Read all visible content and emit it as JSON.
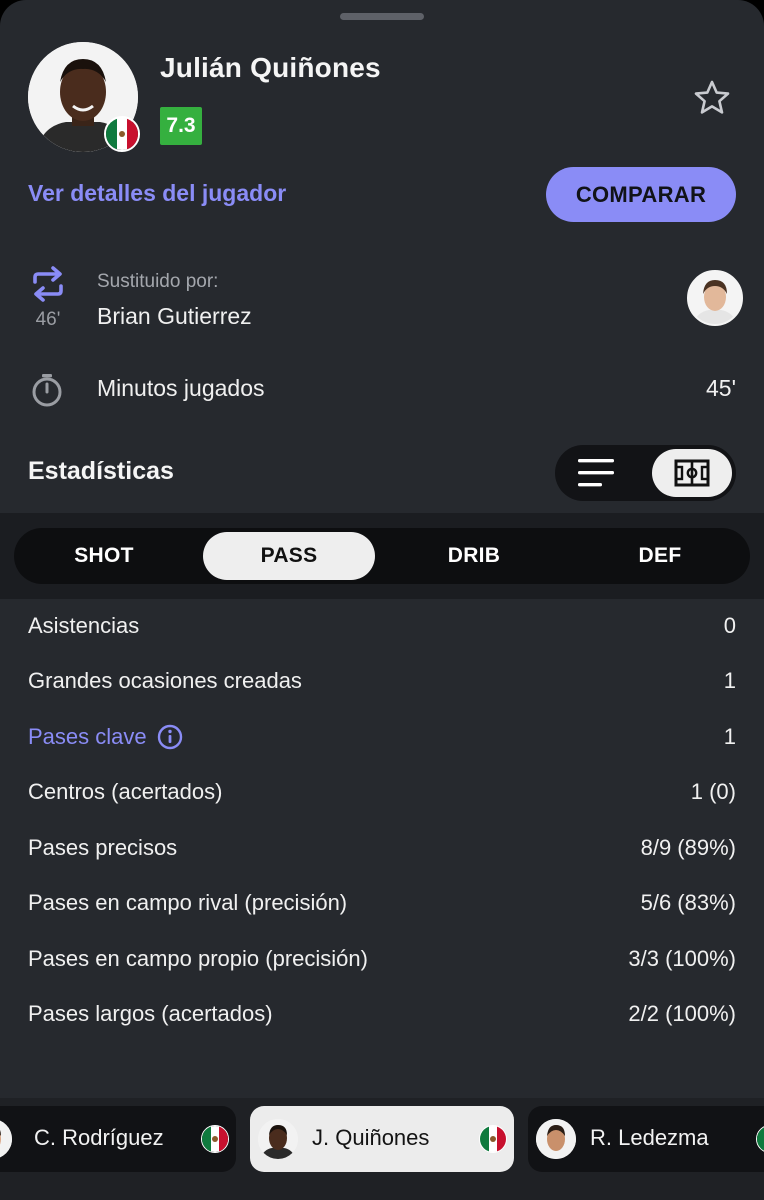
{
  "player": {
    "name": "Julián Quiñones",
    "rating": "7.3",
    "rating_color": "#35b03f",
    "nationality_flag": "mexico-flag-icon"
  },
  "actions": {
    "details_link": "Ver detalles del jugador",
    "compare_button": "COMPARAR"
  },
  "substitution": {
    "minute": "46'",
    "label": "Sustituido por:",
    "replacement": "Brian Gutierrez"
  },
  "minutes_played": {
    "label": "Minutos jugados",
    "value": "45'"
  },
  "stats": {
    "title": "Estadísticas",
    "tabs": [
      "SHOT",
      "PASS",
      "DRIB",
      "DEF"
    ],
    "active_tab": "PASS",
    "rows": [
      {
        "label": "Asistencias",
        "value": "0"
      },
      {
        "label": "Grandes ocasiones creadas",
        "value": "1"
      },
      {
        "label": "Pases clave",
        "value": "1"
      },
      {
        "label": "Centros (acertados)",
        "value": "1 (0)"
      },
      {
        "label": "Pases precisos",
        "value": "8/9 (89%)"
      },
      {
        "label": "Pases en campo rival (precisión)",
        "value": "5/6 (83%)"
      },
      {
        "label": "Pases en campo propio (precisión)",
        "value": "3/3 (100%)"
      },
      {
        "label": "Pases largos (acertados)",
        "value": "2/2 (100%)"
      }
    ]
  },
  "carousel": {
    "players": [
      {
        "name": "C. Rodríguez"
      },
      {
        "name": "J. Quiñones"
      },
      {
        "name": "R. Ledezma"
      }
    ]
  },
  "colors": {
    "accent": "#8a8cf6",
    "background": "#26292e"
  }
}
